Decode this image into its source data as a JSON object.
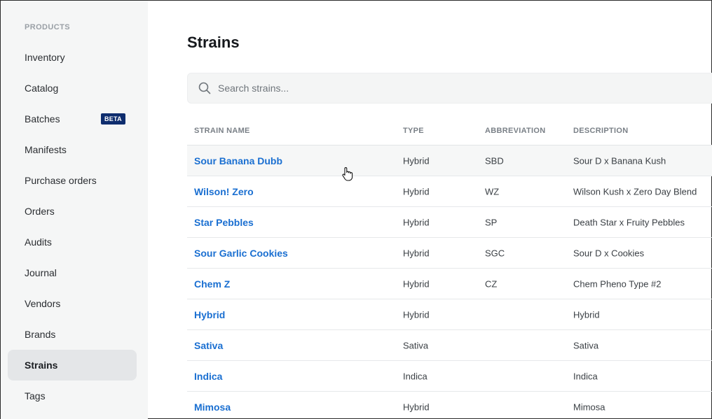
{
  "sidebar": {
    "section_label": "PRODUCTS",
    "items": [
      {
        "label": "Inventory"
      },
      {
        "label": "Catalog"
      },
      {
        "label": "Batches",
        "badge": "BETA"
      },
      {
        "label": "Manifests"
      },
      {
        "label": "Purchase orders"
      },
      {
        "label": "Orders"
      },
      {
        "label": "Audits"
      },
      {
        "label": "Journal"
      },
      {
        "label": "Vendors"
      },
      {
        "label": "Brands"
      },
      {
        "label": "Strains",
        "active": true
      },
      {
        "label": "Tags"
      }
    ]
  },
  "main": {
    "title": "Strains",
    "search": {
      "placeholder": "Search strains...",
      "value": ""
    },
    "table": {
      "columns": [
        "STRAIN NAME",
        "TYPE",
        "ABBREVIATION",
        "DESCRIPTION"
      ],
      "rows": [
        {
          "name": "Sour Banana Dubb",
          "type": "Hybrid",
          "abbr": "SBD",
          "desc": "Sour D x Banana Kush"
        },
        {
          "name": "Wilson! Zero",
          "type": "Hybrid",
          "abbr": "WZ",
          "desc": "Wilson Kush x Zero Day Blend"
        },
        {
          "name": "Star Pebbles",
          "type": "Hybrid",
          "abbr": "SP",
          "desc": "Death Star x Fruity Pebbles"
        },
        {
          "name": "Sour Garlic Cookies",
          "type": "Hybrid",
          "abbr": "SGC",
          "desc": "Sour D x Cookies"
        },
        {
          "name": "Chem Z",
          "type": "Hybrid",
          "abbr": "CZ",
          "desc": "Chem Pheno Type #2"
        },
        {
          "name": "Hybrid",
          "type": "Hybrid",
          "abbr": "",
          "desc": "Hybrid"
        },
        {
          "name": "Sativa",
          "type": "Sativa",
          "abbr": "",
          "desc": "Sativa"
        },
        {
          "name": "Indica",
          "type": "Indica",
          "abbr": "",
          "desc": "Indica"
        },
        {
          "name": "Mimosa",
          "type": "Hybrid",
          "abbr": "",
          "desc": "Mimosa"
        }
      ]
    }
  },
  "colors": {
    "link": "#1a6fd1",
    "badge_bg": "#0e2d6e",
    "sidebar_bg": "#f5f6f6",
    "active_bg": "#e4e6e8"
  }
}
